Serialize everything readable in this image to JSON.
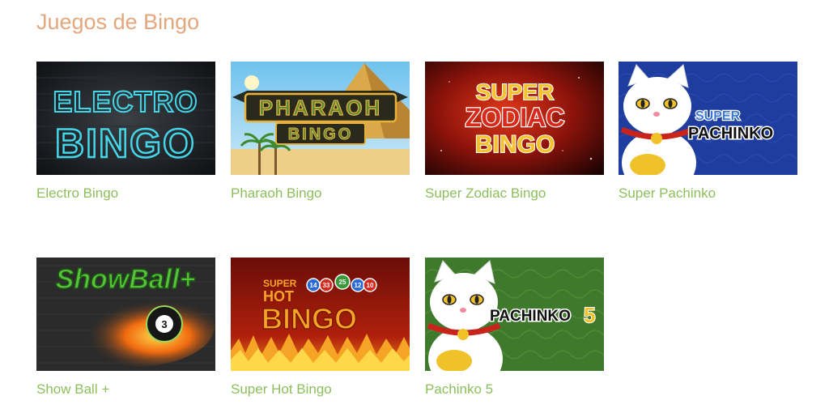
{
  "section": {
    "title": "Juegos de Bingo"
  },
  "games": [
    {
      "name": "Electro Bingo",
      "art": [
        "ELECTRO",
        "BINGO"
      ]
    },
    {
      "name": "Pharaoh Bingo",
      "art": [
        "PHARAOH",
        "BINGO"
      ]
    },
    {
      "name": "Super Zodiac Bingo",
      "art": [
        "SUPER",
        "ZODIAC",
        "BINGO"
      ]
    },
    {
      "name": "Super Pachinko",
      "art": [
        "SUPER",
        "PACHINKO"
      ]
    },
    {
      "name": "Show Ball +",
      "art": [
        "ShowBall+",
        "3"
      ]
    },
    {
      "name": "Super Hot Bingo",
      "art": [
        "SUPER",
        "HOT",
        "BINGO",
        "14",
        "33",
        "25",
        "12",
        "10"
      ]
    },
    {
      "name": "Pachinko 5",
      "art": [
        "PACHINKO",
        "5"
      ]
    }
  ],
  "colors": {
    "title": "#e3a77d",
    "link": "#8cbf5c",
    "electro_neon": "#43d6e8",
    "pharaoh_gold": "#e8b23a",
    "zodiac_red": "#b81b10",
    "pachinko_blue": "#1f3d9e",
    "showball_green": "#57c23a",
    "hot_orange": "#f08a1c",
    "pachinko5_green": "#3f7a2c"
  },
  "icons": [
    "maneki-neko-cat-icon",
    "bingo-ball-icon",
    "pyramid-icon",
    "palm-tree-icon"
  ]
}
